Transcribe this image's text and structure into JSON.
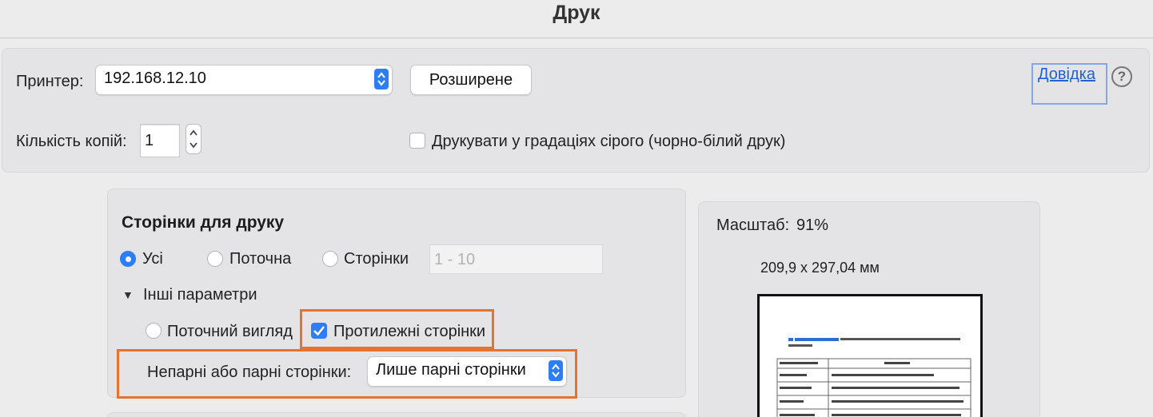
{
  "window": {
    "title": "Друк"
  },
  "printer": {
    "label": "Принтер:",
    "value": "192.168.12.10"
  },
  "advanced_button": "Розширене",
  "help": {
    "link": "Довідка",
    "icon": "question-icon",
    "glyph": "?"
  },
  "copies": {
    "label": "Кількість копій:",
    "value": "1"
  },
  "grayscale": {
    "label": "Друкувати у градаціях сірого (чорно-білий друк)",
    "checked": false
  },
  "pages": {
    "title": "Сторінки для друку",
    "options": [
      {
        "label": "Усі",
        "selected": true
      },
      {
        "label": "Поточна",
        "selected": false
      },
      {
        "label": "Сторінки",
        "selected": false
      }
    ],
    "range_placeholder": "1 - 10",
    "more_options": {
      "label": "Інші параметри",
      "current_view": "Поточний вигляд",
      "opposite_pages": {
        "label": "Протилежні сторінки",
        "checked": true
      },
      "odd_even": {
        "label": "Непарні або парні сторінки:",
        "value": "Лише парні сторінки"
      }
    }
  },
  "preview": {
    "scale_label": "Масштаб:",
    "scale_value": "91%",
    "size": "209,9 x 297,04 мм"
  },
  "colors": {
    "accent": "#2d7df6",
    "highlight": "#e3732d",
    "link": "#2160d6",
    "help_box": "#84a6ef"
  }
}
